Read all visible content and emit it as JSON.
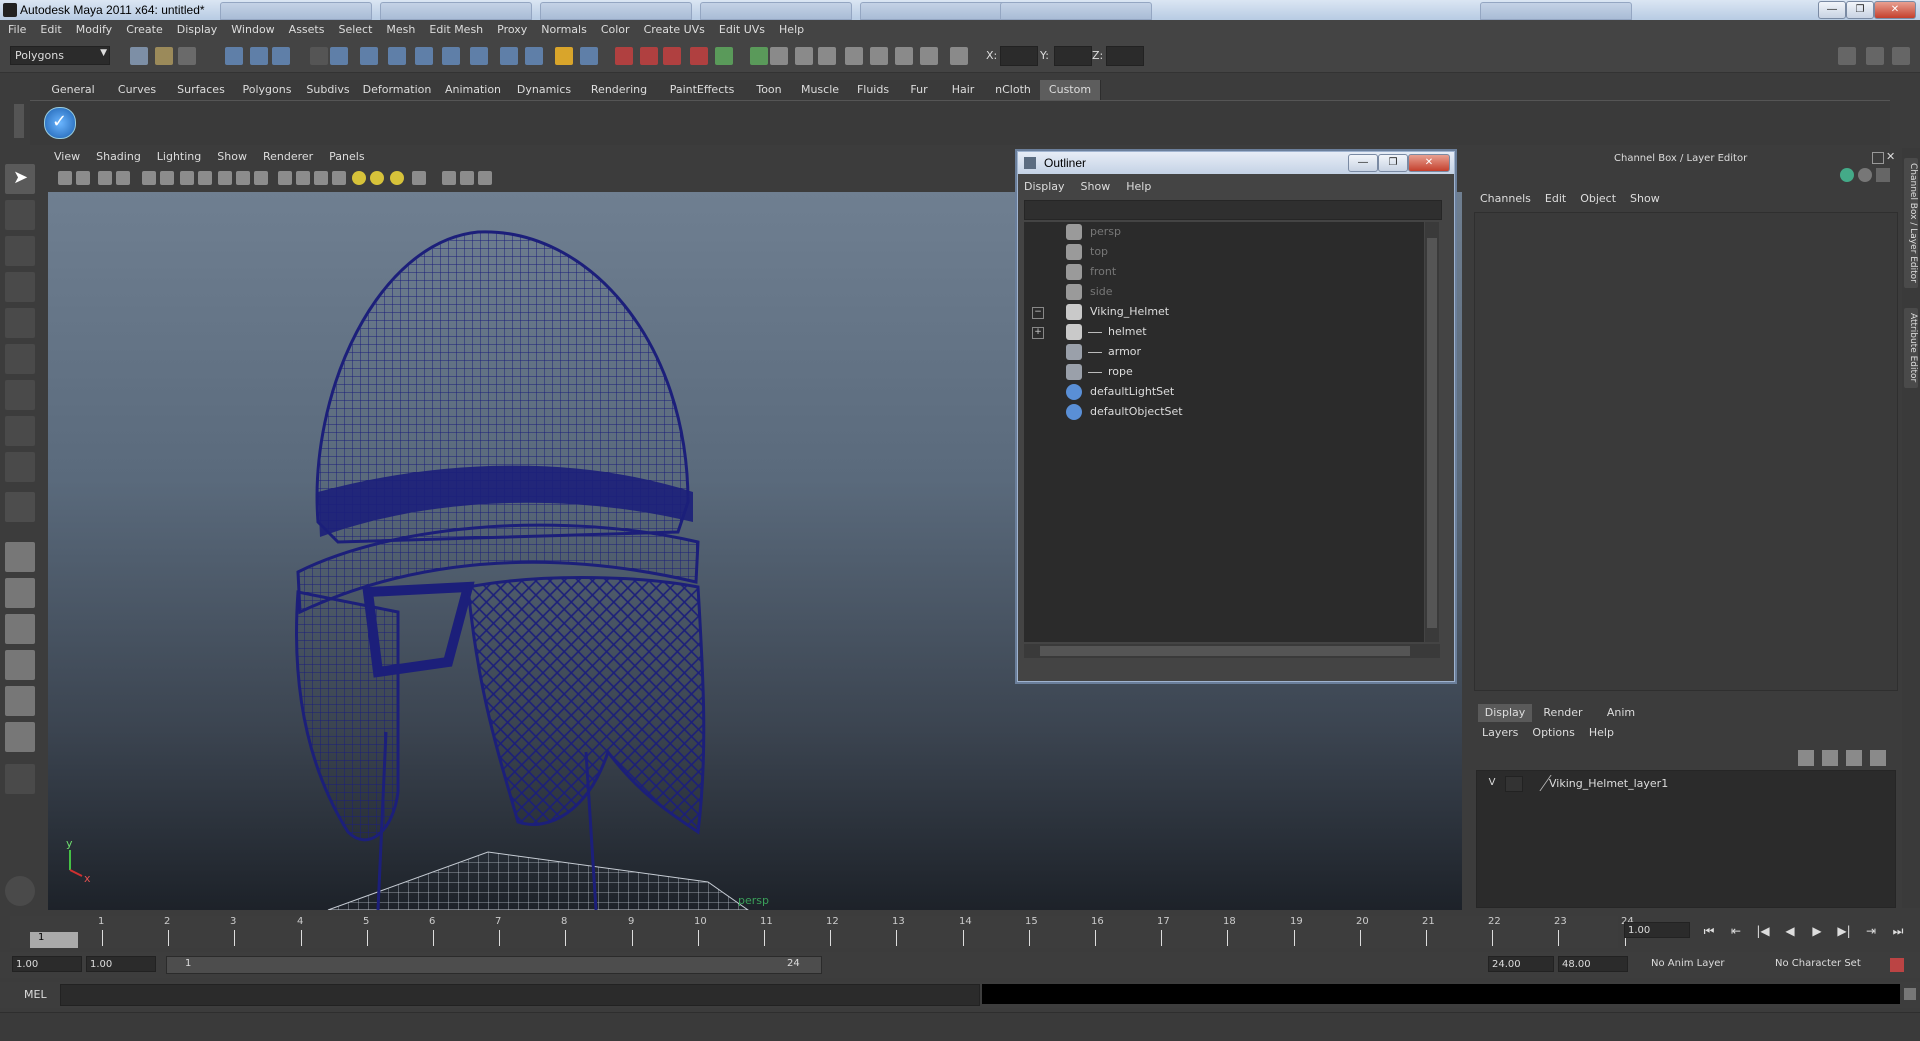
{
  "window": {
    "title": "Autodesk Maya 2011 x64: untitled*",
    "controls": [
      "—",
      "❐",
      "✕"
    ]
  },
  "menubar": [
    "File",
    "Edit",
    "Modify",
    "Create",
    "Display",
    "Window",
    "Assets",
    "Select",
    "Mesh",
    "Edit Mesh",
    "Proxy",
    "Normals",
    "Color",
    "Create UVs",
    "Edit UVs",
    "Help"
  ],
  "toolbar": {
    "mode": "Polygons",
    "x_label": "X:",
    "y_label": "Y:",
    "z_label": "Z:"
  },
  "shelf_tabs": [
    "General",
    "Curves",
    "Surfaces",
    "Polygons",
    "Subdivs",
    "Deformation",
    "Animation",
    "Dynamics",
    "Rendering",
    "PaintEffects",
    "Toon",
    "Muscle",
    "Fluids",
    "Fur",
    "Hair",
    "nCloth",
    "Custom"
  ],
  "active_shelf": "Custom",
  "viewport": {
    "menu": [
      "View",
      "Shading",
      "Lighting",
      "Show",
      "Renderer",
      "Panels"
    ],
    "camera_label": "persp",
    "axis_y": "y",
    "axis_x": "x",
    "wire_color": "#1c1f7a"
  },
  "outliner": {
    "title": "Outliner",
    "menu": [
      "Display",
      "Show",
      "Help"
    ],
    "items": [
      {
        "label": "persp",
        "icon": "camera-icon",
        "dim": true,
        "indent": 0
      },
      {
        "label": "top",
        "icon": "camera-icon",
        "dim": true,
        "indent": 0
      },
      {
        "label": "front",
        "icon": "camera-icon",
        "dim": true,
        "indent": 0
      },
      {
        "label": "side",
        "icon": "camera-icon",
        "dim": true,
        "indent": 0
      },
      {
        "label": "Viking_Helmet",
        "icon": "transform-icon",
        "dim": false,
        "indent": 0,
        "expander": "−"
      },
      {
        "label": "helmet",
        "icon": "transform-icon",
        "dim": false,
        "indent": 1,
        "expander": "+"
      },
      {
        "label": "armor",
        "icon": "mesh-icon",
        "dim": false,
        "indent": 1
      },
      {
        "label": "rope",
        "icon": "mesh-icon",
        "dim": false,
        "indent": 1
      },
      {
        "label": "defaultLightSet",
        "icon": "set-icon",
        "dim": false,
        "indent": 0
      },
      {
        "label": "defaultObjectSet",
        "icon": "set-icon",
        "dim": false,
        "indent": 0
      }
    ]
  },
  "channelbox": {
    "title": "Channel Box / Layer Editor",
    "menu": [
      "Channels",
      "Edit",
      "Object",
      "Show"
    ]
  },
  "side_tabs": [
    "Channel Box / Layer Editor",
    "Attribute Editor"
  ],
  "layer_editor": {
    "tabs": [
      "Display",
      "Render",
      "Anim"
    ],
    "active_tab": "Display",
    "menu": [
      "Layers",
      "Options",
      "Help"
    ],
    "layers": [
      {
        "visible": "V",
        "name": "Viking_Helmet_layer1"
      }
    ]
  },
  "timeline": {
    "ticks": [
      "1",
      "2",
      "3",
      "4",
      "5",
      "6",
      "7",
      "8",
      "9",
      "10",
      "11",
      "12",
      "13",
      "14",
      "15",
      "16",
      "17",
      "18",
      "19",
      "20",
      "21",
      "22",
      "23",
      "24"
    ],
    "current_frame": "1",
    "current_time_field": "1.00"
  },
  "playback": [
    "⏮",
    "⇤",
    "|◀",
    "◀",
    "▶",
    "▶|",
    "⇥",
    "⏭"
  ],
  "range": {
    "start_a": "1.00",
    "start_b": "1.00",
    "slider_start": "1",
    "slider_end": "24",
    "end_a": "24.00",
    "end_b": "48.00",
    "anim_layer": "No Anim Layer",
    "char_set": "No Character Set"
  },
  "mel": {
    "label": "MEL"
  }
}
